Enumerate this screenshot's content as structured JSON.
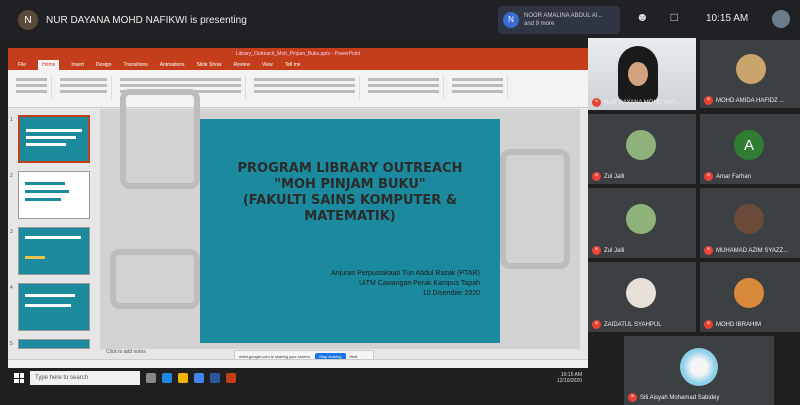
{
  "meet": {
    "presenter_initial": "N",
    "presenter_text": "NUR DAYANA MOHD NAFIKWI is presenting",
    "notification_initial": "N",
    "notification_line1": "NOOR AMALINA ABDUL AI...",
    "notification_line2": "and 9 more",
    "clock": "10:15 AM"
  },
  "ppt": {
    "title_bar": "Library_Outreach_Moh_Pinjam_Buku.pptx - PowerPoint",
    "tabs": [
      "File",
      "Home",
      "Insert",
      "Design",
      "Transitions",
      "Animations",
      "Slide Show",
      "Review",
      "View",
      "Tell me"
    ],
    "active_tab": "Home",
    "slide_title_lines": [
      "PROGRAM LIBRARY OUTREACH",
      "\"MOH PINJAM BUKU\"",
      "(FAKULTI SAINS KOMPUTER &",
      "MATEMATIK)"
    ],
    "slide_sub_lines": [
      "Anjuran Perpustakaan Tun Abdul Razak (PTAR)",
      "UiTM Cawangan Perak Kampus Tapah",
      "10 Disember 2020"
    ],
    "notes_placeholder": "Click to add notes",
    "share_text": "meet.google.com is sharing your screen.",
    "stop_label": "Stop sharing",
    "hide_label": "Hide",
    "thumb_numbers": [
      "1",
      "2",
      "3",
      "4",
      "5"
    ]
  },
  "taskbar": {
    "search_placeholder": "Type here to search",
    "time": "10:15 AM",
    "date": "12/10/2020"
  },
  "participants": [
    {
      "name": "NUR DAYANA MOHD NAF..."
    },
    {
      "name": "MOHD AMIDA HAFIDZ ..."
    },
    {
      "name": "Zul Jalil"
    },
    {
      "name": "Amar Farhan",
      "initial": "A"
    },
    {
      "name": "Zul Jalil"
    },
    {
      "name": "MUHAMAD AZIM SYAZZ..."
    },
    {
      "name": "ZAIDATUL SYAHPUL"
    },
    {
      "name": "MOHD IBRAHIM"
    },
    {
      "name": "Siti Aisyah Mohamad Sabidey"
    }
  ],
  "colors": {
    "meet_bg": "#202124",
    "ppt_accent": "#c43e1c",
    "slide_bg": "#1b8a9e",
    "mic_off": "#ea4335"
  }
}
